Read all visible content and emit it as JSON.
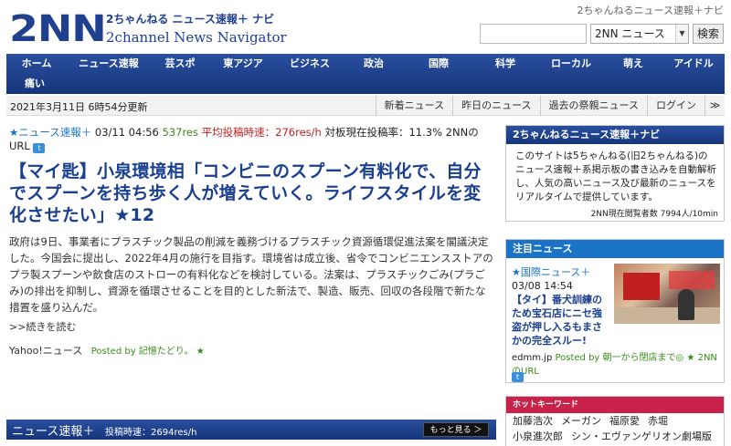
{
  "header": {
    "tagline": "2ちゃんねるニュース速報＋ナビ",
    "logo_mark": "2NN",
    "logo_jp": "2ちゃんねる ニュース速報＋ ナビ",
    "logo_en": "2channel News Navigator",
    "search_placeholder": "",
    "search_select": "2NN ニュース",
    "search_button": "検索"
  },
  "nav": {
    "row1": [
      "ホーム",
      "ニュース速報",
      "芸スポ",
      "東アジア",
      "ビジネス",
      "政治",
      "国際",
      "科学",
      "ローカル",
      "萌え",
      "アイドル"
    ],
    "row2": [
      "痛い"
    ]
  },
  "subbar": {
    "date": "2021年3月11日 6時54分更新",
    "links": [
      "新着ニュース",
      "昨日のニュース",
      "過去の祭親ニュース",
      "ログイン",
      "≫"
    ]
  },
  "article": {
    "board": "★ニュース速報＋",
    "time": "03/11 04:56",
    "res": "537res",
    "rate_label": "平均投稿時速：276res/h",
    "post_rate": "対板現在投稿率：11.3%",
    "url_label": "2NNのURL",
    "headline": "【マイ匙】小泉環境相「コンビニのスプーン有料化で、自分でスプーンを持ち歩く人が増えていく。ライフスタイルを変化させたい」★12",
    "body": "政府は9日、事業者にプラスチック製品の削減を義務づけるプラスチック資源循環促進法案を閣議決定した。今国会に提出し、2022年4月の施行を目指す。環境省は成立後、省令でコンビニエンスストアのプラ製スプーンや飲食店のストローの有料化などを検討している。法案は、プラスチックごみ(プラごみ)の排出を抑制し、資源を循環させることを目的とした新法で、製造、販売、回収の各段階で新たな措置を盛り込んだ。",
    "more": ">>続きを読む",
    "source": "Yahoo!ニュース",
    "posted": "Posted by 記憶たどり。 ★"
  },
  "bottombar": {
    "title": "ニュース速報＋",
    "rate": "投稿時速：2694res/h",
    "more": "もっと見る ＞"
  },
  "about": {
    "title": "2ちゃんねるニュース速報＋ナビ",
    "text": "このサイトは5ちゃんねる(旧2ちゃんねる)のニュース速報＋系掲示板の書き込みを自動解析し、人気の高いニュース及び最新のニュースをリアルタイムで提供しています。",
    "count": "2NN現在閲覧者数 7994人/10min"
  },
  "attention": {
    "title": "注目ニュース",
    "board": "★国際ニュース＋",
    "time": "03/08 14:54",
    "headline": "【タイ】番犬訓練のため宝石店にニセ強盗が押し入るもまさかの完全スルー!",
    "source": "edmm.jp",
    "posted": "Posted by 朝一から閉店まで◎ ★ 2NNのURL"
  },
  "hot": {
    "title": "ホットキーワード",
    "row1": [
      "加藤浩次",
      "メーガン",
      "福原愛",
      "赤堀"
    ],
    "row2": [
      "小泉進次郎",
      "シン・エヴァンゲリオン劇場版"
    ]
  }
}
